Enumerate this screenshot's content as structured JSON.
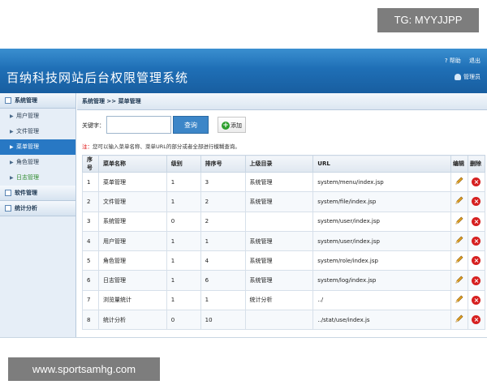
{
  "watermark_top": "TG: MYYJJPP",
  "watermark_bottom": "www.sportsamhg.com",
  "header": {
    "title": "百纳科技网站后台权限管理系统",
    "help": "? 帮助",
    "logout": "退出",
    "user": "管理员"
  },
  "sidebar": {
    "groups": [
      {
        "label": "系统管理"
      },
      {
        "label": "软件管理"
      },
      {
        "label": "统计分析"
      }
    ],
    "items": [
      {
        "label": "用户管理"
      },
      {
        "label": "文件管理"
      },
      {
        "label": "菜单管理"
      },
      {
        "label": "角色管理"
      },
      {
        "label": "日志管理"
      }
    ]
  },
  "breadcrumb": "系统管理 >> 菜单管理",
  "search": {
    "label": "关键字：",
    "value": "",
    "button": "查询",
    "add": "添加"
  },
  "note": {
    "star": "注：",
    "text": "您可以输入菜单名称、菜单URL的部分或者全部进行模糊查询。"
  },
  "table": {
    "headers": [
      "序号",
      "菜单名称",
      "级别",
      "排序号",
      "上级目录",
      "URL",
      "编辑",
      "删除"
    ],
    "rows": [
      [
        "1",
        "菜单管理",
        "1",
        "3",
        "系统管理",
        "system/menu/index.jsp"
      ],
      [
        "2",
        "文件管理",
        "1",
        "2",
        "系统管理",
        "system/file/index.jsp"
      ],
      [
        "3",
        "系统管理",
        "0",
        "2",
        "",
        "system/user/index.jsp"
      ],
      [
        "4",
        "用户管理",
        "1",
        "1",
        "系统管理",
        "system/user/index.jsp"
      ],
      [
        "5",
        "角色管理",
        "1",
        "4",
        "系统管理",
        "system/role/index.jsp"
      ],
      [
        "6",
        "日志管理",
        "1",
        "6",
        "系统管理",
        "system/log/index.jsp"
      ],
      [
        "7",
        "浏览量统计",
        "1",
        "1",
        "统计分析",
        "../"
      ],
      [
        "8",
        "统计分析",
        "0",
        "10",
        "",
        "../stat/use/index.js"
      ]
    ]
  },
  "icons": {
    "edit": "pencil-icon",
    "delete": "delete-icon"
  },
  "colors": {
    "header": "#1f6fb6",
    "active": "#2878c4",
    "delete": "#d62020",
    "add": "#2c9e2c"
  }
}
